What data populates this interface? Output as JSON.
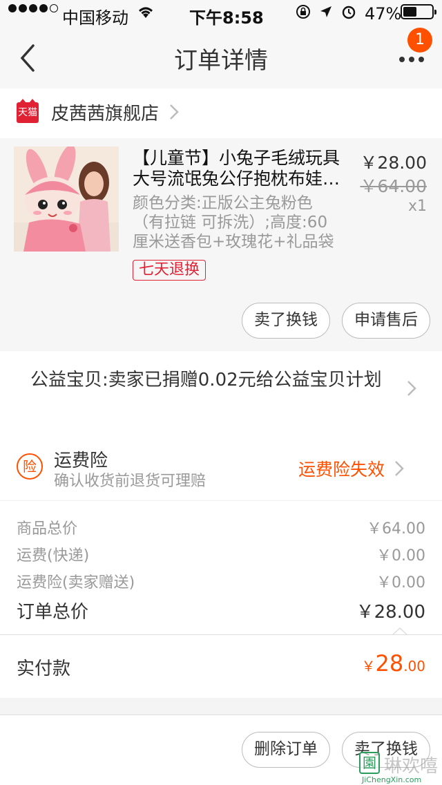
{
  "status_bar": {
    "carrier": "中国移动",
    "time": "下午8:58",
    "battery": "47%",
    "battery_level": 0.47
  },
  "nav": {
    "title": "订单详情",
    "badge_count": "1"
  },
  "shop": {
    "logo_text": "天猫",
    "name": "皮茜茜旗舰店"
  },
  "item": {
    "title_lines": [
      "【儿童节】小兔子毛绒玩具",
      "大号流氓兔公仔抱枕布娃…"
    ],
    "sku_lines": [
      "颜色分类:正版公主兔粉色",
      "（有拉链 可拆洗）;高度:60",
      "厘米送香包+玫瑰花+礼品袋"
    ],
    "price": "￥28.00",
    "original_price": "￥64.00",
    "quantity": "x1",
    "return_tag": "七天退换",
    "sell_button": "卖了换钱",
    "after_sale_button": "申请售后"
  },
  "charity": {
    "text": "公益宝贝:卖家已捐赠0.02元给公益宝贝计划"
  },
  "insurance": {
    "icon_text": "险",
    "title": "运费险",
    "subtitle": "确认收货前退货可理赔",
    "status": "运费险失效"
  },
  "summary": {
    "rows": [
      {
        "label": "商品总价",
        "value": "￥64.00"
      },
      {
        "label": "运费(快递)",
        "value": "￥0.00"
      },
      {
        "label": "运费险(卖家赠送)",
        "value": "￥0.00"
      }
    ],
    "total_label": "订单总价",
    "total_value": "￥28.00"
  },
  "payment": {
    "label": "实付款",
    "currency": "￥",
    "integer": "28",
    "decimal": ".00"
  },
  "bottom": {
    "delete_button": "删除订单",
    "sell_button": "卖了换钱"
  },
  "watermark": {
    "logo": "園",
    "text": "琳欢嘻",
    "url": "JiChengXin.com"
  },
  "colors": {
    "accent": "#ff5000",
    "tmall_red": "#e02033",
    "muted_text": "#999999"
  },
  "icons": [
    "back-chevron-icon",
    "more-dots-icon",
    "tmall-icon",
    "chevron-right-icon",
    "insurance-icon",
    "wifi-icon",
    "location-arrow-icon",
    "alarm-icon",
    "orientation-lock-icon"
  ]
}
